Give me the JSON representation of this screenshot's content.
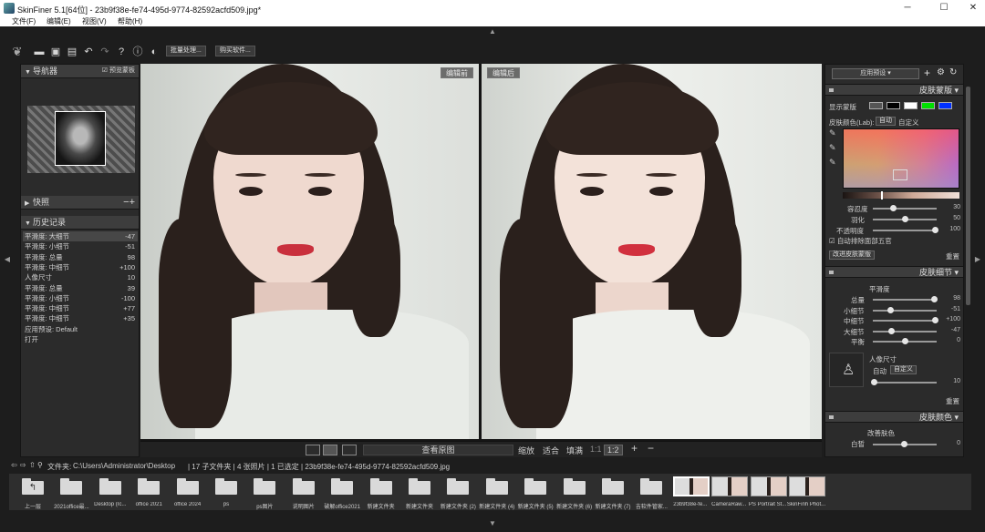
{
  "titlebar": {
    "title": "SkinFiner 5.1[64位] - 23b9f38e-fe74-495d-9774-82592acfd509.jpg*",
    "minimize": "─",
    "maximize": "☐",
    "close": "✕"
  },
  "menu": {
    "file": "文件(F)",
    "edit": "编辑(E)",
    "view": "视图(V)",
    "help": "帮助(H)"
  },
  "toolbar": {
    "batch": "批量处理...",
    "buy": "购买软件..."
  },
  "navigator": {
    "title": "导航器",
    "preview_check": "预览蒙板"
  },
  "snapshot": {
    "title": "快照"
  },
  "history": {
    "title": "历史记录",
    "rows": [
      {
        "label": "平滑度: 大细节",
        "value": "-47"
      },
      {
        "label": "平滑度: 小细节",
        "value": "-51"
      },
      {
        "label": "平滑度: 总量",
        "value": "98"
      },
      {
        "label": "平滑度: 中细节",
        "value": "+100"
      },
      {
        "label": "人像尺寸",
        "value": "10"
      },
      {
        "label": "平滑度: 总量",
        "value": "39"
      },
      {
        "label": "平滑度: 小细节",
        "value": "-100"
      },
      {
        "label": "平滑度: 中细节",
        "value": "+77"
      },
      {
        "label": "平滑度: 中细节",
        "value": "+35"
      },
      {
        "label": "应用预设: Default",
        "value": ""
      },
      {
        "label": "打开",
        "value": ""
      }
    ]
  },
  "canvas": {
    "before_tag": "编辑前",
    "after_tag": "编辑后",
    "view_original": "查看原图",
    "zoom": "缩放",
    "fit": "适合",
    "fill": "填满",
    "ratio1": "1:1",
    "ratio2": "1:2"
  },
  "right": {
    "preset": "应用预设",
    "skin_mask": {
      "title": "皮肤蒙版",
      "show_mask": "显示蒙版",
      "skin_color": "皮肤颜色(Lab):",
      "auto": "自动",
      "custom": "自定义",
      "tolerance": "容忍度",
      "tolerance_val": "30",
      "feather": "羽化",
      "feather_val": "50",
      "opacity": "不透明度",
      "opacity_val": "100",
      "auto_exclude": "自动排除面部五官",
      "improve_btn": "改进皮肤蒙版",
      "reset": "重置"
    },
    "skin_detail": {
      "title": "皮肤细节",
      "smooth_label": "平滑度",
      "rows": [
        {
          "label": "总量",
          "value": "98",
          "pct": 0.98
        },
        {
          "label": "小细节",
          "value": "-51",
          "pct": 0.25
        },
        {
          "label": "中细节",
          "value": "+100",
          "pct": 1.0
        },
        {
          "label": "大细节",
          "value": "-47",
          "pct": 0.27
        },
        {
          "label": "平衡",
          "value": "0",
          "pct": 0.5
        }
      ],
      "portrait": "人像尺寸",
      "p_auto": "自动",
      "p_custom": "自定义",
      "p_val": "10",
      "reset": "重置"
    },
    "skin_color": {
      "title": "皮肤颜色",
      "sub": "改善肤色",
      "whiten": "白皙",
      "whiten_val": "0"
    }
  },
  "filebar": {
    "prefix": "文件夹:",
    "path": "C:\\Users\\Administrator\\Desktop",
    "info": "| 17 子文件夹 | 4 张照片 | 1 已选定 | 23b9f38e-fe74-495d-9774-82592acfd509.jpg"
  },
  "filmstrip": [
    {
      "kind": "up",
      "caption": "上一层"
    },
    {
      "kind": "folder",
      "caption": "2021office最..."
    },
    {
      "kind": "folder",
      "caption": "Desktop (Ic..."
    },
    {
      "kind": "folder",
      "caption": "office 2021"
    },
    {
      "kind": "folder",
      "caption": "office 2024"
    },
    {
      "kind": "folder",
      "caption": "ps"
    },
    {
      "kind": "folder",
      "caption": "ps图片"
    },
    {
      "kind": "folder",
      "caption": "说明图片"
    },
    {
      "kind": "folder",
      "caption": "破解office2021"
    },
    {
      "kind": "folder",
      "caption": "新建文件夹"
    },
    {
      "kind": "folder",
      "caption": "新建文件夹"
    },
    {
      "kind": "folder",
      "caption": "新建文件夹 (2)"
    },
    {
      "kind": "folder",
      "caption": "新建文件夹 (4)"
    },
    {
      "kind": "folder",
      "caption": "新建文件夹 (5)"
    },
    {
      "kind": "folder",
      "caption": "新建文件夹 (6)"
    },
    {
      "kind": "folder",
      "caption": "新建文件夹 (7)"
    },
    {
      "kind": "folder",
      "caption": "吉软件管家..."
    },
    {
      "kind": "photo",
      "caption": "23b9f38e-fe..."
    },
    {
      "kind": "photo",
      "caption": "CameraRaw..."
    },
    {
      "kind": "photo",
      "caption": "PS Portrait St..."
    },
    {
      "kind": "photo",
      "caption": "SkinFinh Phot..."
    }
  ]
}
